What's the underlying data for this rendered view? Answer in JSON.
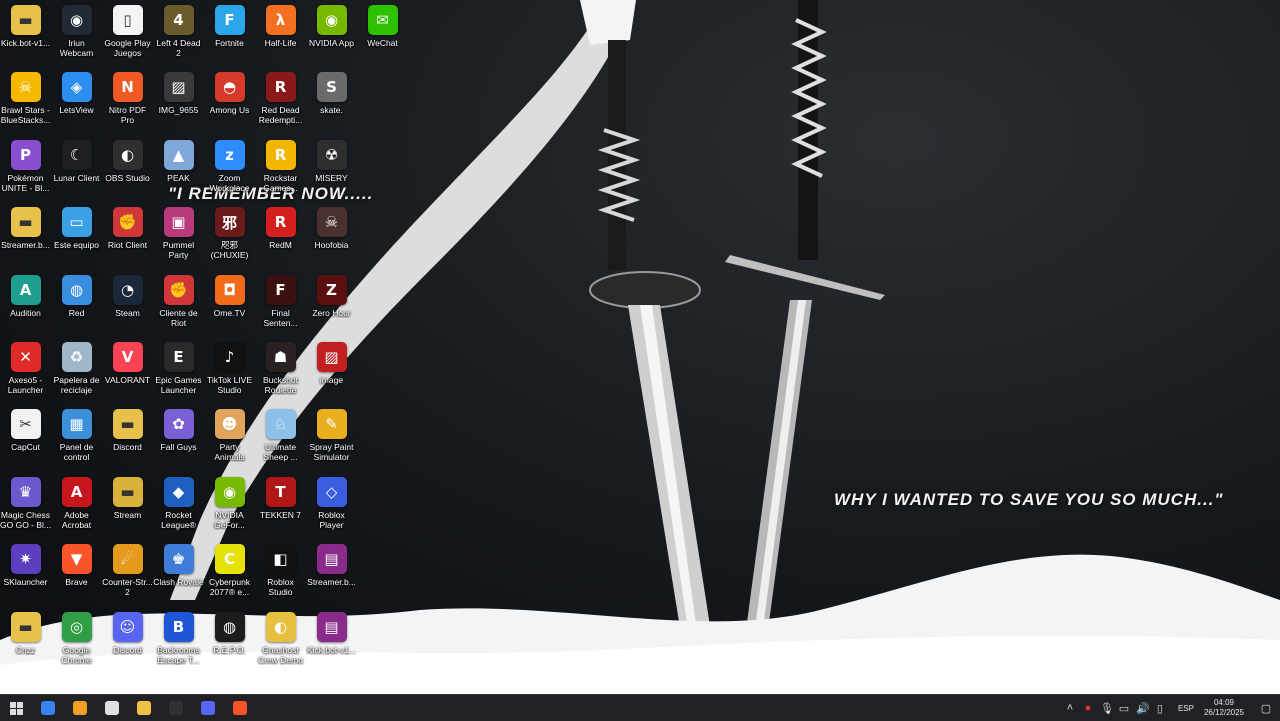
{
  "wallpaper": {
    "quote_top": "\"I REMEMBER NOW.....",
    "quote_bottom": "WHY I WANTED TO SAVE YOU SO MUCH...\""
  },
  "desktop_icons": [
    {
      "label": "Kick.bot-v1...",
      "icon": "folder-icon",
      "color": "#e8c14a",
      "glyph": "▬"
    },
    {
      "label": "Brawl Stars - BlueStacks...",
      "icon": "brawl-stars-icon",
      "color": "#f5b800",
      "glyph": "☠"
    },
    {
      "label": "Pokémon UNITE - Bl...",
      "icon": "pokemon-unite-icon",
      "color": "#8a4fd0",
      "glyph": "P"
    },
    {
      "label": "Streamer.b...",
      "icon": "folder-icon",
      "color": "#e8c14a",
      "glyph": "▬"
    },
    {
      "label": "Audition",
      "icon": "audition-icon",
      "color": "#1f9e8f",
      "glyph": "A"
    },
    {
      "label": "Axeso5 - Launcher",
      "icon": "axeso5-icon",
      "color": "#e02a2a",
      "glyph": "✕"
    },
    {
      "label": "CapCut",
      "icon": "capcut-icon",
      "color": "#f2f2f2",
      "glyph": "✂"
    },
    {
      "label": "Magic Chess GO GO - Bl...",
      "icon": "magic-chess-icon",
      "color": "#6a5acd",
      "glyph": "♛"
    },
    {
      "label": "SKlauncher",
      "icon": "sklauncher-icon",
      "color": "#5b3fbf",
      "glyph": "✷"
    },
    {
      "label": "Cnzz",
      "icon": "folder-icon",
      "color": "#e8c14a",
      "glyph": "▬"
    },
    {
      "label": "Iriun Webcam",
      "icon": "webcam-icon",
      "color": "#222a36",
      "glyph": "◉"
    },
    {
      "label": "LetsView",
      "icon": "letsview-icon",
      "color": "#2b8ef0",
      "glyph": "◈"
    },
    {
      "label": "Lunar Client",
      "icon": "lunar-client-icon",
      "color": "#1d1f24",
      "glyph": "☾"
    },
    {
      "label": "Este equipo",
      "icon": "computer-icon",
      "color": "#3ba0e6",
      "glyph": "▭"
    },
    {
      "label": "Red",
      "icon": "network-icon",
      "color": "#3a8ee0",
      "glyph": "◍"
    },
    {
      "label": "Papelera de reciclaje",
      "icon": "recycle-bin-icon",
      "color": "#9fb7c9",
      "glyph": "♻"
    },
    {
      "label": "Panel de control",
      "icon": "control-panel-icon",
      "color": "#3b90d8",
      "glyph": "▦"
    },
    {
      "label": "Adobe Acrobat",
      "icon": "acrobat-icon",
      "color": "#c8161d",
      "glyph": "A"
    },
    {
      "label": "Brave",
      "icon": "brave-icon",
      "color": "#fb542b",
      "glyph": "▼"
    },
    {
      "label": "Google Chrome",
      "icon": "chrome-icon",
      "color": "#2f9e44",
      "glyph": "◎"
    },
    {
      "label": "Google Play Juegos",
      "icon": "file-icon",
      "color": "#f4f4f4",
      "glyph": "▯"
    },
    {
      "label": "Nitro PDF Pro",
      "icon": "nitro-pdf-icon",
      "color": "#f05a22",
      "glyph": "N"
    },
    {
      "label": "OBS Studio",
      "icon": "obs-icon",
      "color": "#302e31",
      "glyph": "◐"
    },
    {
      "label": "Riot Client",
      "icon": "riot-client-icon",
      "color": "#d13639",
      "glyph": "✊"
    },
    {
      "label": "Steam",
      "icon": "steam-icon",
      "color": "#1b2838",
      "glyph": "◔"
    },
    {
      "label": "VALORANT",
      "icon": "valorant-icon",
      "color": "#fa4454",
      "glyph": "V"
    },
    {
      "label": "Discord",
      "icon": "folder-icon",
      "color": "#e8c14a",
      "glyph": "▬"
    },
    {
      "label": "Stream",
      "icon": "folder-icon",
      "color": "#d9b23a",
      "glyph": "▬"
    },
    {
      "label": "Counter-Str... 2",
      "icon": "counter-strike-icon",
      "color": "#e49a1c",
      "glyph": "☄"
    },
    {
      "label": "Discord",
      "icon": "discord-icon",
      "color": "#5865f2",
      "glyph": "☺"
    },
    {
      "label": "Left 4 Dead 2",
      "icon": "left4dead-icon",
      "color": "#6b5a2a",
      "glyph": "4"
    },
    {
      "label": "IMG_9655",
      "icon": "image-file-icon",
      "color": "#3a3a3a",
      "glyph": "▨"
    },
    {
      "label": "PEAK",
      "icon": "peak-icon",
      "color": "#7fa7d9",
      "glyph": "▲"
    },
    {
      "label": "Pummel Party",
      "icon": "pummel-party-icon",
      "color": "#b83a7a",
      "glyph": "▣"
    },
    {
      "label": "Cliente de Riot",
      "icon": "riot-icon",
      "color": "#d13639",
      "glyph": "✊"
    },
    {
      "label": "Epic Games Launcher",
      "icon": "epic-games-icon",
      "color": "#2a2a2a",
      "glyph": "E"
    },
    {
      "label": "Fall Guys",
      "icon": "fall-guys-icon",
      "color": "#7a5fd6",
      "glyph": "✿"
    },
    {
      "label": "Rocket League®",
      "icon": "rocket-league-icon",
      "color": "#1f5fbf",
      "glyph": "◆"
    },
    {
      "label": "Clash Royale",
      "icon": "clash-royale-icon",
      "color": "#3d7dd8",
      "glyph": "♚"
    },
    {
      "label": "Backrooms Escape T...",
      "icon": "backrooms-icon",
      "color": "#1f56d6",
      "glyph": "B"
    },
    {
      "label": "Fortnite",
      "icon": "fortnite-icon",
      "color": "#2aa5e8",
      "glyph": "F"
    },
    {
      "label": "Among Us",
      "icon": "among-us-icon",
      "color": "#d63a2a",
      "glyph": "◓"
    },
    {
      "label": "Zoom Workplace",
      "icon": "zoom-icon",
      "color": "#2d8cff",
      "glyph": "z"
    },
    {
      "label": "咫邪 (CHUXIE)",
      "icon": "chuxie-icon",
      "color": "#6a1a1a",
      "glyph": "邪"
    },
    {
      "label": "Ome.TV",
      "icon": "ome-tv-icon",
      "color": "#f06a1a",
      "glyph": "◘"
    },
    {
      "label": "TikTok LIVE Studio",
      "icon": "tiktok-icon",
      "color": "#111111",
      "glyph": "♪"
    },
    {
      "label": "Party Animals",
      "icon": "party-animals-icon",
      "color": "#e0a45a",
      "glyph": "☻"
    },
    {
      "label": "NVIDIA GeFor...",
      "icon": "nvidia-geforce-icon",
      "color": "#76b900",
      "glyph": "◉"
    },
    {
      "label": "Cyberpunk 2077® e...",
      "icon": "cyberpunk-icon",
      "color": "#e6e20a",
      "glyph": "C"
    },
    {
      "label": "R.E.P.O.",
      "icon": "repo-icon",
      "color": "#1c1c1c",
      "glyph": "◍"
    },
    {
      "label": "Half-Life",
      "icon": "half-life-icon",
      "color": "#f37021",
      "glyph": "λ"
    },
    {
      "label": "Red Dead Redempti...",
      "icon": "red-dead-icon",
      "color": "#8a1a1a",
      "glyph": "R"
    },
    {
      "label": "Rockstar Games...",
      "icon": "rockstar-icon",
      "color": "#f2b600",
      "glyph": "R"
    },
    {
      "label": "RedM",
      "icon": "redm-icon",
      "color": "#d62020",
      "glyph": "R"
    },
    {
      "label": "Final Senten...",
      "icon": "final-sentence-icon",
      "color": "#3a1010",
      "glyph": "F"
    },
    {
      "label": "Buckshot Roulette",
      "icon": "buckshot-icon",
      "color": "#2a2222",
      "glyph": "☗"
    },
    {
      "label": "Ultimate Sheep ...",
      "icon": "ultimate-sheep-icon",
      "color": "#8cc0e8",
      "glyph": "♘"
    },
    {
      "label": "TEKKEN 7",
      "icon": "tekken-icon",
      "color": "#b01818",
      "glyph": "T"
    },
    {
      "label": "Roblox Studio",
      "icon": "roblox-studio-icon",
      "color": "#111111",
      "glyph": "◧"
    },
    {
      "label": "Gnashost Crew Demo",
      "icon": "gnashost-icon",
      "color": "#e8c040",
      "glyph": "◐"
    },
    {
      "label": "NVIDIA App",
      "icon": "nvidia-icon",
      "color": "#76b900",
      "glyph": "◉"
    },
    {
      "label": "skate.",
      "icon": "skate-icon",
      "color": "#6a6a6a",
      "glyph": "S"
    },
    {
      "label": "MISERY",
      "icon": "misery-icon",
      "color": "#2e2e2e",
      "glyph": "☢"
    },
    {
      "label": "Hoofobia",
      "icon": "hoofobia-icon",
      "color": "#4a3030",
      "glyph": "☠"
    },
    {
      "label": "Zero Hour",
      "icon": "zero-hour-icon",
      "color": "#5a1010",
      "glyph": "Z"
    },
    {
      "label": "image",
      "icon": "image-file-icon",
      "color": "#c02020",
      "glyph": "▨"
    },
    {
      "label": "Spray Paint Simulator",
      "icon": "spray-paint-icon",
      "color": "#e8b020",
      "glyph": "✎"
    },
    {
      "label": "Roblox Player",
      "icon": "roblox-icon",
      "color": "#3b5de0",
      "glyph": "◇"
    },
    {
      "label": "Streamer.b...",
      "icon": "winrar-icon",
      "color": "#8a2a8a",
      "glyph": "▤"
    },
    {
      "label": "Kick.bot-v1...",
      "icon": "winrar-icon",
      "color": "#8a2a8a",
      "glyph": "▤"
    },
    {
      "label": "WeChat",
      "icon": "wechat-icon",
      "color": "#2dc100",
      "glyph": "✉"
    }
  ],
  "taskbar": {
    "start_icon": "windows-start-icon",
    "apps": [
      {
        "name": "copilot-icon",
        "color": "#3b82f6"
      },
      {
        "name": "widgets-icon",
        "color": "#f0a020"
      },
      {
        "name": "store-icon",
        "color": "#e0e0e0"
      },
      {
        "name": "file-explorer-icon",
        "color": "#f0c040"
      },
      {
        "name": "obs-icon",
        "color": "#302e31"
      },
      {
        "name": "discord-icon",
        "color": "#5865f2"
      },
      {
        "name": "brave-icon",
        "color": "#fb542b"
      }
    ],
    "tray": {
      "language": "ESP",
      "time": "04:09",
      "date": "26/12/2025"
    }
  }
}
